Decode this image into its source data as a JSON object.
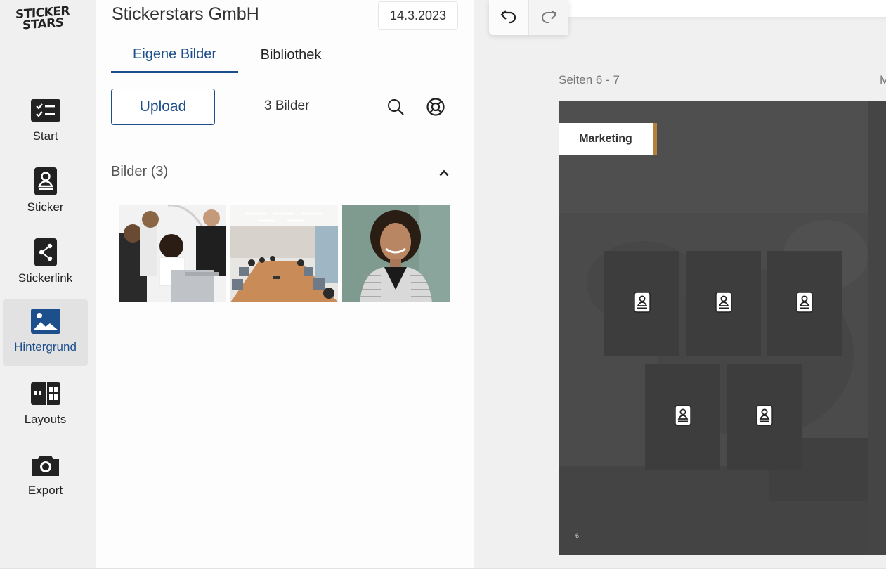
{
  "logo": {
    "line1": "STICKER",
    "line2": "STARS"
  },
  "nav": {
    "items": [
      {
        "label": "Start",
        "icon": "checklist-icon"
      },
      {
        "label": "Sticker",
        "icon": "sticker-person-icon"
      },
      {
        "label": "Stickerlink",
        "icon": "share-icon"
      },
      {
        "label": "Hintergrund",
        "icon": "image-icon",
        "active": true
      },
      {
        "label": "Layouts",
        "icon": "layout-grid-icon"
      },
      {
        "label": "Export",
        "icon": "camera-icon"
      }
    ]
  },
  "panel": {
    "company": "Stickerstars GmbH",
    "date": "14.3.2023",
    "tabs": [
      {
        "label": "Eigene Bilder",
        "active": true
      },
      {
        "label": "Bibliothek"
      }
    ],
    "upload_label": "Upload",
    "count_label": "3 Bilder",
    "section_title": "Bilder (3)",
    "thumbnails": [
      "team-laptop-photo",
      "meeting-room-photo",
      "portrait-woman-photo"
    ]
  },
  "canvas": {
    "pages_label": "Seiten 6 - 7",
    "partial_label": "M",
    "section_tag": "Marketing",
    "page_number": "6",
    "sticker_slots": 5
  },
  "colors": {
    "accent": "#1d4f8c",
    "tag_border": "#b3813a",
    "page_bg": "#4a4a4a"
  }
}
